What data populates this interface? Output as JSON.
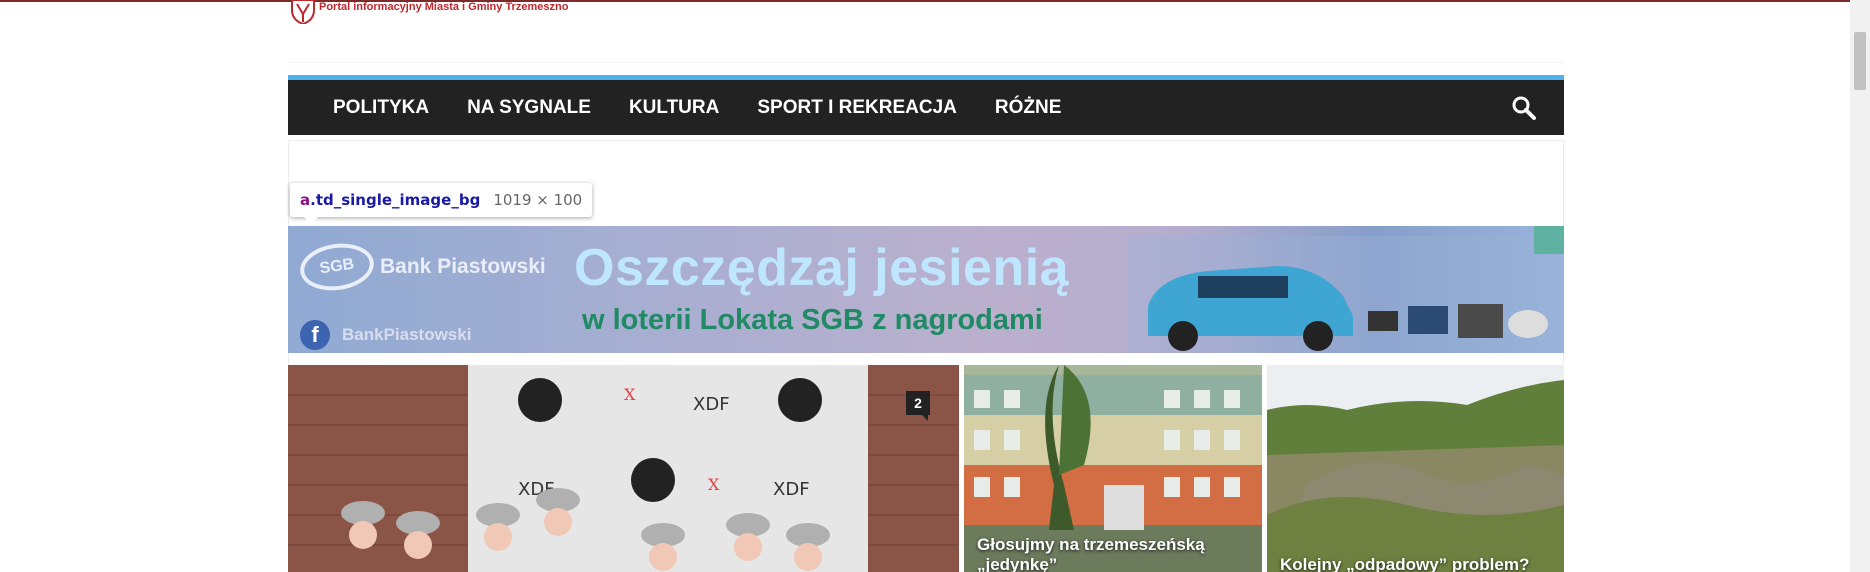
{
  "site": {
    "tagline": "Portal informacyjny Miasta i Gminy Trzemeszno",
    "logo_icon": "crest-icon"
  },
  "nav": {
    "items": [
      "POLITYKA",
      "NA SYGNALE",
      "KULTURA",
      "SPORT I REKREACJA",
      "RÓŻNE"
    ],
    "search_icon": "search-icon"
  },
  "inspector": {
    "tag": "a",
    "class": ".td_single_image_bg",
    "dims": "1019 × 100"
  },
  "banner": {
    "bank": "Bank Piastowski",
    "logo_text": "SGB",
    "headline": "Oszczędzaj jesienią",
    "subline": "w loterii Lokata SGB z nagrodami",
    "fb_handle": "BankPiastowski"
  },
  "tiles": {
    "main_comments": "2",
    "school_title": "Głosujmy na trzemeszeńską „jedynkę”",
    "field_title": "Kolejny „odpadowy” problem?"
  },
  "colors": {
    "nav_bg": "#222222",
    "nav_accent": "#4db2ec",
    "tagline": "#c0282f"
  }
}
